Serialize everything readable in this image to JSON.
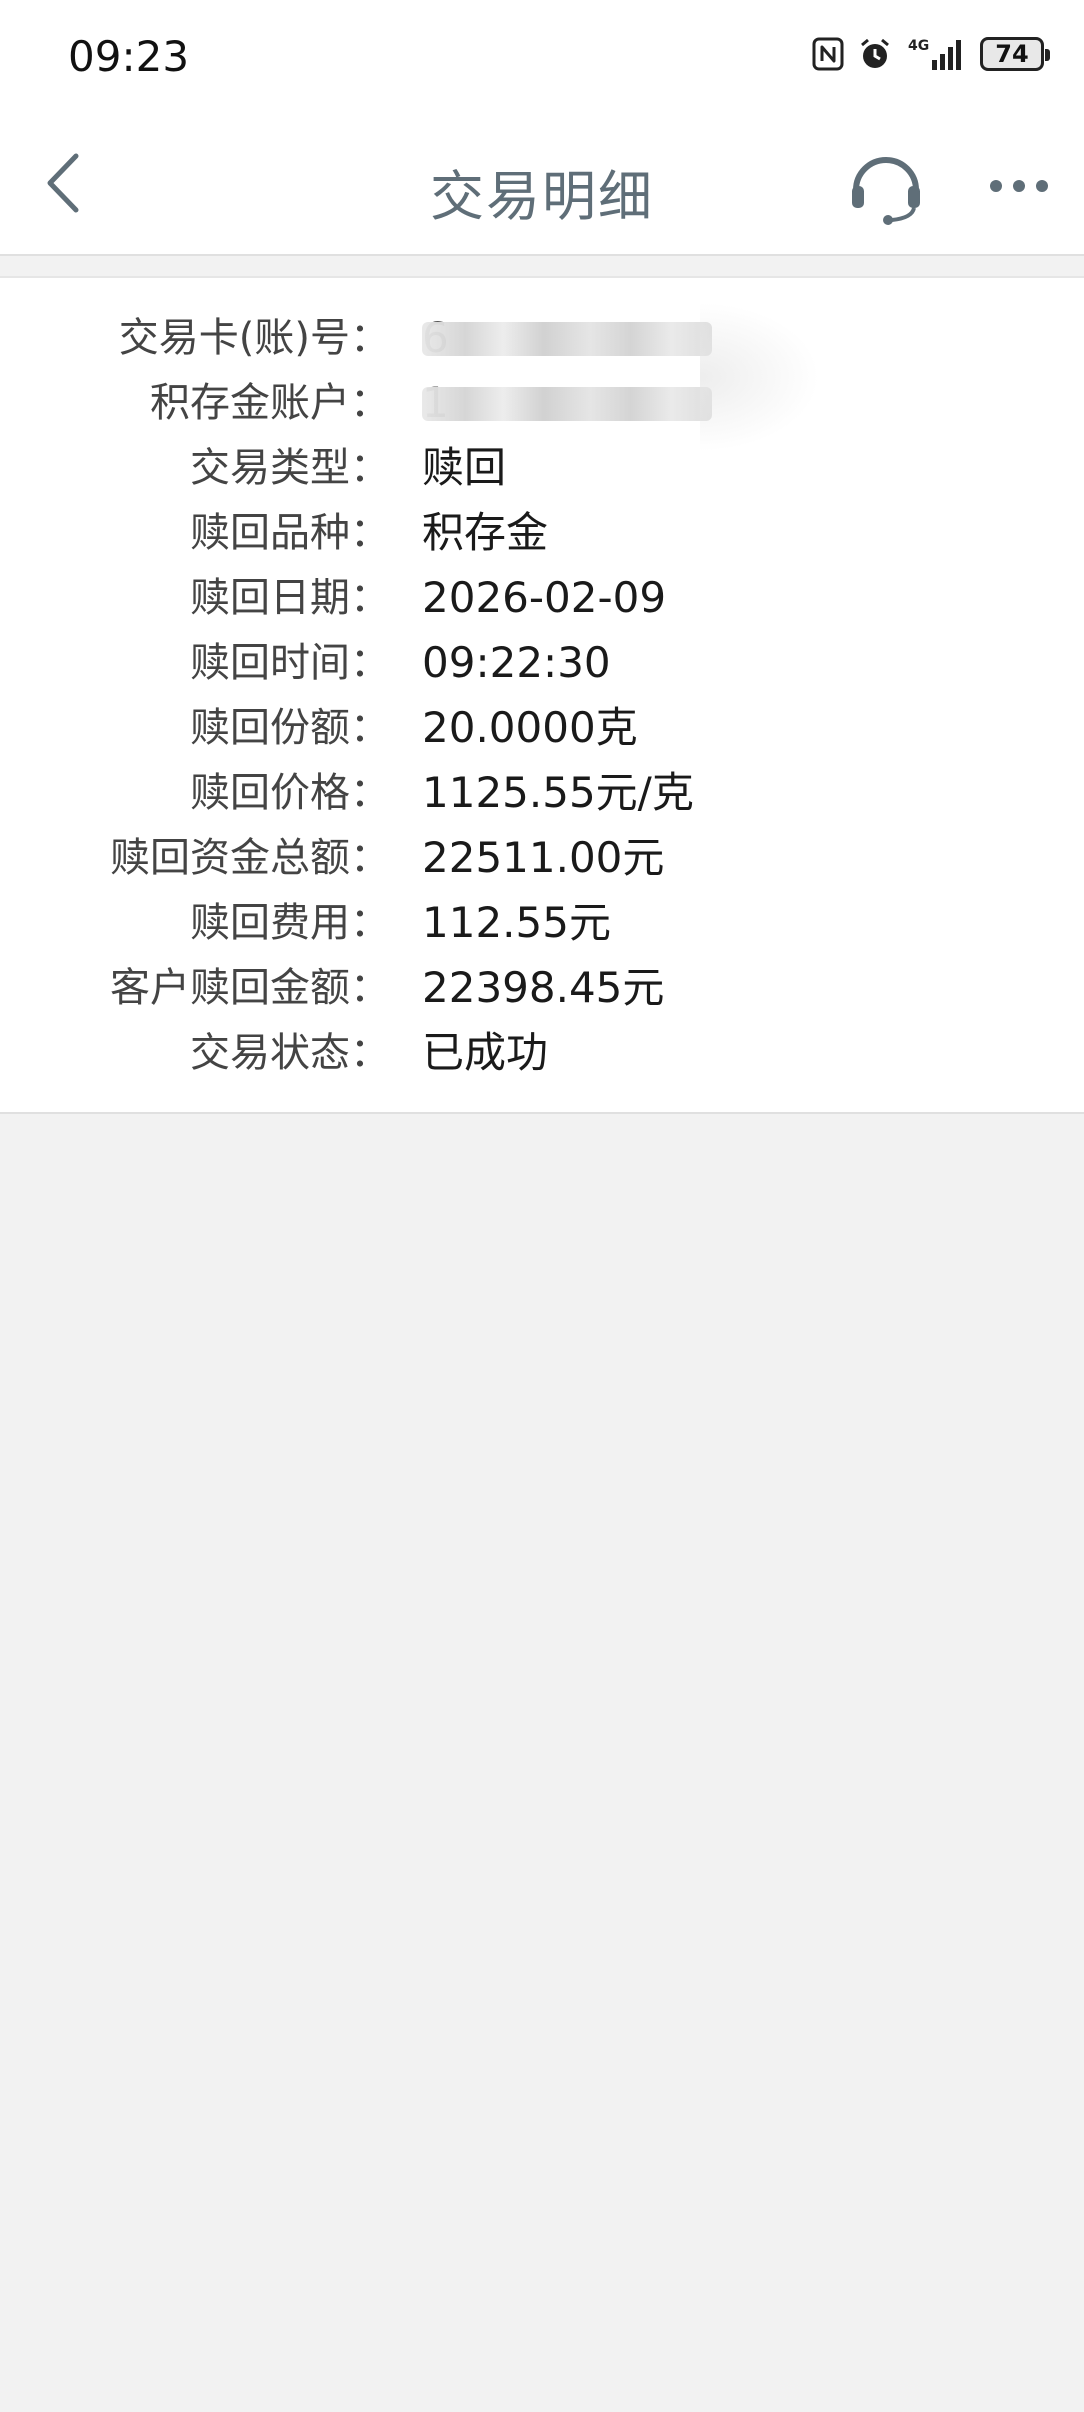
{
  "status_bar": {
    "time": "09:23",
    "network": "4G",
    "battery": "74",
    "icons": [
      "nfc-icon",
      "alarm-icon",
      "signal-icon",
      "battery-icon"
    ]
  },
  "header": {
    "title": "交易明细",
    "back_icon": "chevron-left-icon",
    "service_icon": "headset-icon",
    "more_icon": "more-horizontal-icon"
  },
  "details": [
    {
      "label": "交易卡(账)号：",
      "value": "6",
      "masked": true
    },
    {
      "label": "积存金账户：",
      "value": "1",
      "masked": true
    },
    {
      "label": "交易类型：",
      "value": "赎回",
      "masked": false
    },
    {
      "label": "赎回品种：",
      "value": "积存金",
      "masked": false
    },
    {
      "label": "赎回日期：",
      "value": "2026-02-09",
      "masked": false
    },
    {
      "label": "赎回时间：",
      "value": "09:22:30",
      "masked": false
    },
    {
      "label": "赎回份额：",
      "value": "20.0000克",
      "masked": false
    },
    {
      "label": "赎回价格：",
      "value": "1125.55元/克",
      "masked": false
    },
    {
      "label": "赎回资金总额：",
      "value": "22511.00元",
      "masked": false
    },
    {
      "label": "赎回费用：",
      "value": "112.55元",
      "masked": false
    },
    {
      "label": "客户赎回金额：",
      "value": "22398.45元",
      "masked": false
    },
    {
      "label": "交易状态：",
      "value": "已成功",
      "masked": false
    }
  ],
  "colors": {
    "title": "#5f6e78",
    "background": "#f2f2f2",
    "card": "#ffffff",
    "label": "#444444",
    "value": "#1a1a1a"
  }
}
